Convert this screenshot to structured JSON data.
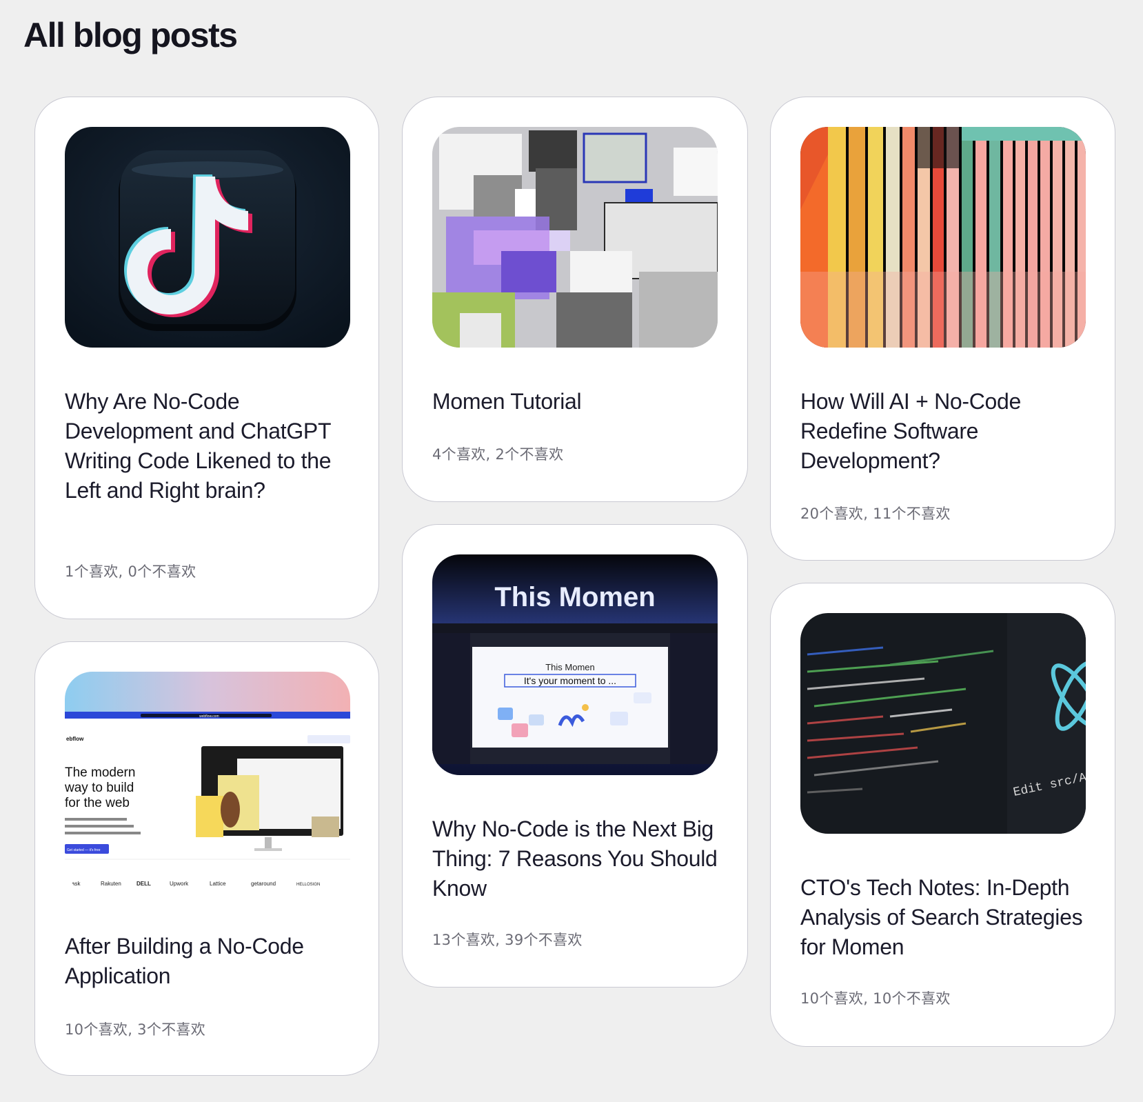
{
  "page": {
    "title": "All blog posts"
  },
  "posts": [
    {
      "title": "Why Are No-Code Development and ChatGPT Writing Code Likened to the Left and Right brain?",
      "stats": "1个喜欢, 0个不喜欢",
      "image": "tiktok-logo-image"
    },
    {
      "title": "Momen Tutorial",
      "stats": "4个喜欢, 2个不喜欢",
      "image": "abstract-voxel-image"
    },
    {
      "title": "How Will AI + No-Code Redefine Software Development?",
      "stats": "20个喜欢, 11个不喜欢",
      "image": "colorful-stripes-image"
    },
    {
      "title": "After Building a No-Code Application",
      "stats": "10个喜欢, 3个不喜欢",
      "image": "webflow-screenshot-image",
      "image_text": {
        "brand": "ebflow",
        "headline_1": "The modern",
        "headline_2": "way to build",
        "headline_3": "for the web",
        "cta": "Get started — it's free",
        "url": "webflow.com",
        "logos": [
          "ask",
          "Rakuten",
          "DELL",
          "Upwork",
          "Lattice",
          "getaround",
          "HELLOSIGN"
        ]
      }
    },
    {
      "title": "Why No-Code is the Next Big Thing: 7 Reasons You Should Know",
      "stats": "13个喜欢, 39个不喜欢",
      "image": "momen-editor-image",
      "image_text": {
        "heading": "This Momen",
        "canvas_title": "This Momen",
        "canvas_tagline": "It's your moment to ..."
      }
    },
    {
      "title": "CTO's Tech Notes: In-Depth Analysis of Search Strategies for Momen",
      "stats": "10个喜欢, 10个不喜欢",
      "image": "code-editor-image",
      "image_text": {
        "caption": "Edit src/App."
      }
    }
  ]
}
